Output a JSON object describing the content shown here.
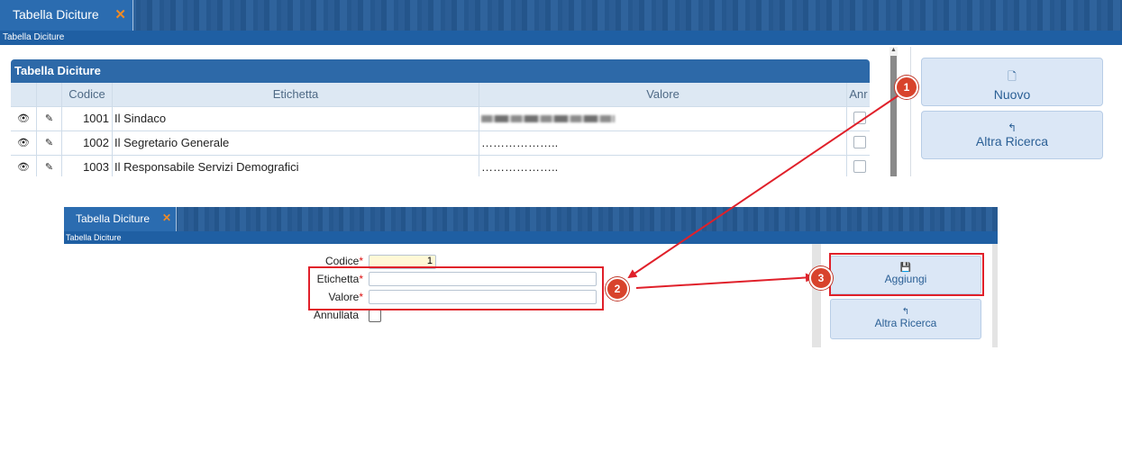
{
  "top": {
    "tab_title": "Tabella Diciture",
    "tab_close": "✕",
    "breadcrumb": "Tabella Diciture",
    "panel_title": "Tabella Diciture",
    "columns": [
      "",
      "",
      "Codice",
      "Etichetta",
      "Valore",
      "Anr"
    ],
    "rows": [
      {
        "codice": "1001",
        "etichetta": "Il Sindaco",
        "valore": ""
      },
      {
        "codice": "1002",
        "etichetta": "Il Segretario Generale",
        "valore": "……………….."
      },
      {
        "codice": "1003",
        "etichetta": "Il Responsabile Servizi Demografici",
        "valore": "……………….."
      }
    ],
    "buttons": {
      "nuovo": "Nuovo",
      "altra_ricerca": "Altra Ricerca"
    }
  },
  "bottom": {
    "tab_title": "Tabella Diciture",
    "tab_close": "✕",
    "breadcrumb": "Tabella Diciture",
    "form": {
      "codice_label": "Codice",
      "codice_value": "1",
      "etichetta_label": "Etichetta",
      "etichetta_value": "",
      "valore_label": "Valore",
      "valore_value": "",
      "annullata_label": "Annullata",
      "required_mark": "*"
    },
    "buttons": {
      "aggiungi": "Aggiungi",
      "altra_ricerca": "Altra Ricerca"
    }
  },
  "annotations": {
    "step1": "1",
    "step2": "2",
    "step3": "3"
  },
  "colors": {
    "accent": "#2b6cb0",
    "highlight": "#e0202a",
    "badge": "#d8432c"
  }
}
